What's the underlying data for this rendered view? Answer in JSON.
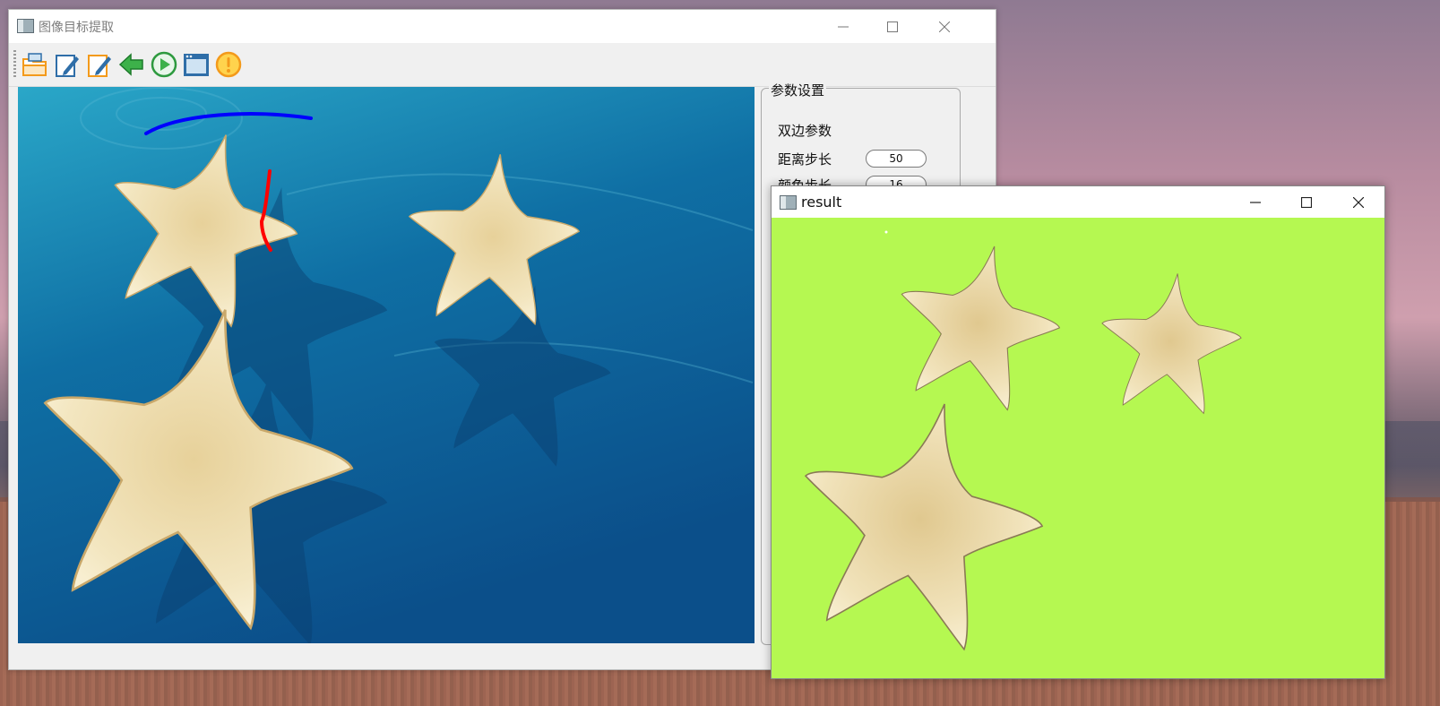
{
  "main_window": {
    "title": "图像目标提取",
    "toolbar": [
      "open-folder-icon",
      "edit-doc-icon",
      "edit-doc-orange-icon",
      "back-arrow-icon",
      "play-icon",
      "window-icon",
      "warning-icon"
    ]
  },
  "params": {
    "group_title": "参数设置",
    "section": "双边参数",
    "distance_label": "距离步长",
    "distance_value": "50",
    "color_label": "颜色步长",
    "color_value": "16"
  },
  "result_window": {
    "title": "result",
    "background": "#b5f851"
  },
  "colors": {
    "ocean": "#0d5c8e",
    "stroke_fg": "#ff0000",
    "stroke_bg": "#0000ff"
  }
}
